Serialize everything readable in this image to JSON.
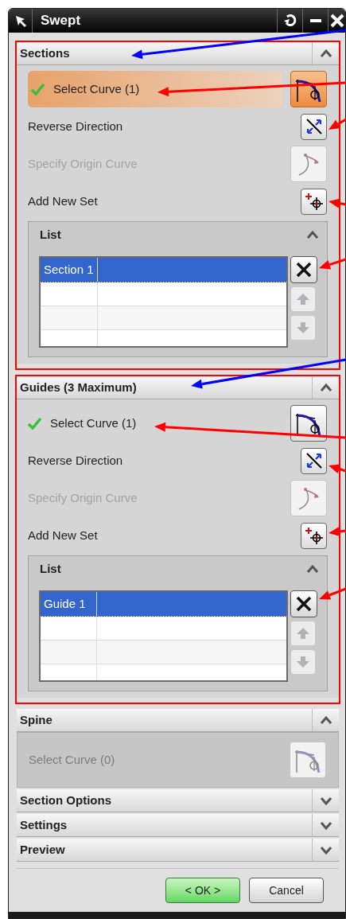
{
  "window": {
    "title": "Swept"
  },
  "groups": [
    {
      "title": "Sections",
      "expanded": true,
      "highlighted": true,
      "annotation": {
        "color": "#0000ff"
      },
      "rows": [
        {
          "kind": "select-curve",
          "label": "Select Curve (1)",
          "complete": true,
          "active": true,
          "disabled": false,
          "annotation": {
            "color": "#ff0000"
          }
        },
        {
          "kind": "reverse",
          "label": "Reverse Direction",
          "disabled": false,
          "annotation": {
            "color": "#ff0000"
          }
        },
        {
          "kind": "origin",
          "label": "Specify Origin Curve",
          "disabled": true
        },
        {
          "kind": "add-set",
          "label": "Add New Set",
          "disabled": false,
          "annotation": {
            "color": "#ff0000"
          }
        }
      ],
      "list": {
        "title": "List",
        "expanded": true,
        "annotation": {
          "color": "#ff0000"
        },
        "items": [
          {
            "label": "Section 1",
            "selected": true
          }
        ]
      }
    },
    {
      "title": "Guides (3 Maximum)",
      "expanded": true,
      "highlighted": true,
      "annotation": {
        "color": "#0000ff"
      },
      "rows": [
        {
          "kind": "select-curve",
          "label": "Select Curve (1)",
          "complete": true,
          "active": false,
          "disabled": false,
          "annotation": {
            "color": "#ff0000"
          }
        },
        {
          "kind": "reverse",
          "label": "Reverse Direction",
          "disabled": false,
          "annotation": {
            "color": "#ff0000"
          }
        },
        {
          "kind": "origin",
          "label": "Specify Origin Curve",
          "disabled": true
        },
        {
          "kind": "add-set",
          "label": "Add New Set",
          "disabled": false,
          "annotation": {
            "color": "#ff0000"
          }
        }
      ],
      "list": {
        "title": "List",
        "expanded": true,
        "annotation": {
          "color": "#ff0000"
        },
        "items": [
          {
            "label": "Guide 1",
            "selected": true
          }
        ]
      }
    },
    {
      "title": "Spine",
      "expanded": true,
      "disabled": true,
      "rows": [
        {
          "kind": "select-curve",
          "label": "Select Curve (0)",
          "complete": false,
          "active": false,
          "disabled": true
        }
      ]
    },
    {
      "title": "Section Options",
      "expanded": false
    },
    {
      "title": "Settings",
      "expanded": false
    },
    {
      "title": "Preview",
      "expanded": false
    }
  ],
  "buttons": [
    {
      "label": "< OK >",
      "default": true
    },
    {
      "label": "Cancel",
      "default": false
    }
  ]
}
